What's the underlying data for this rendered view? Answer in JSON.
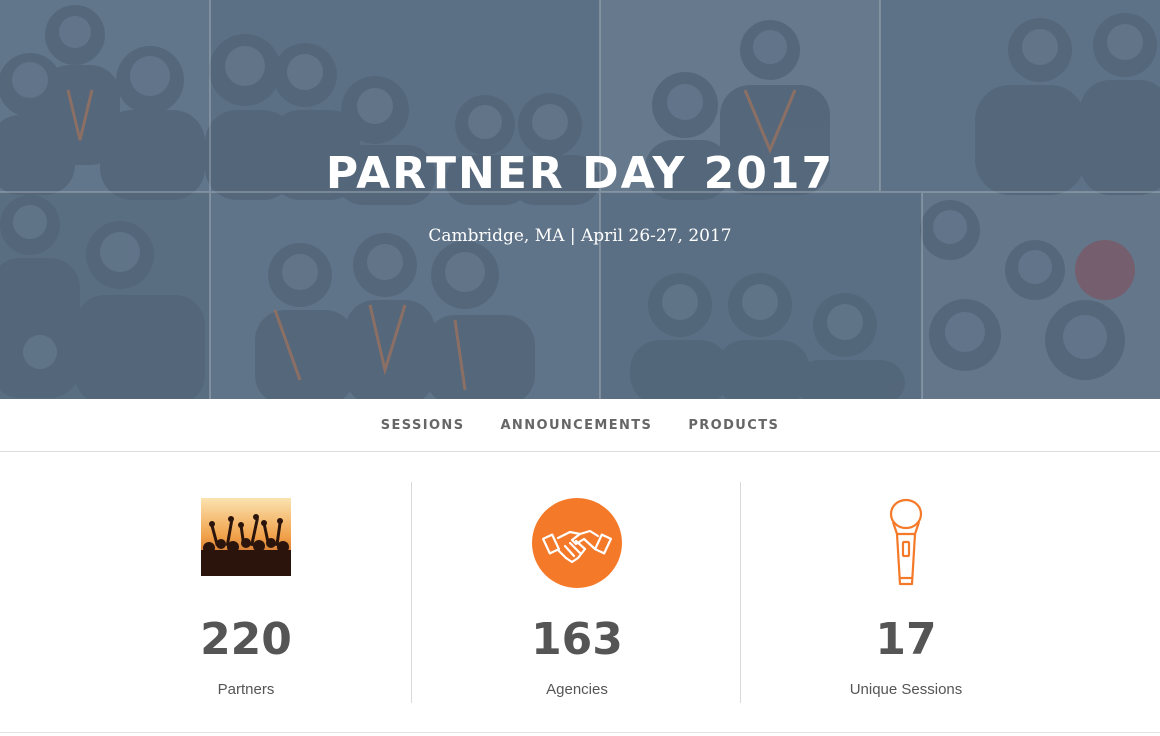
{
  "hero": {
    "title": "PARTNER DAY 2017",
    "subtitle": "Cambridge, MA | April 26-27, 2017",
    "overlay_color": "#5f7388"
  },
  "nav": {
    "items": [
      {
        "label": "SESSIONS"
      },
      {
        "label": "ANNOUNCEMENTS"
      },
      {
        "label": "PRODUCTS"
      }
    ]
  },
  "stats": [
    {
      "value": "220",
      "label": "Partners",
      "icon": "crowd-photo-icon"
    },
    {
      "value": "163",
      "label": "Agencies",
      "icon": "handshake-icon"
    },
    {
      "value": "17",
      "label": "Unique Sessions",
      "icon": "microphone-icon"
    }
  ],
  "colors": {
    "accent": "#f47a2a",
    "text": "#555555",
    "nav_text": "#666666"
  }
}
